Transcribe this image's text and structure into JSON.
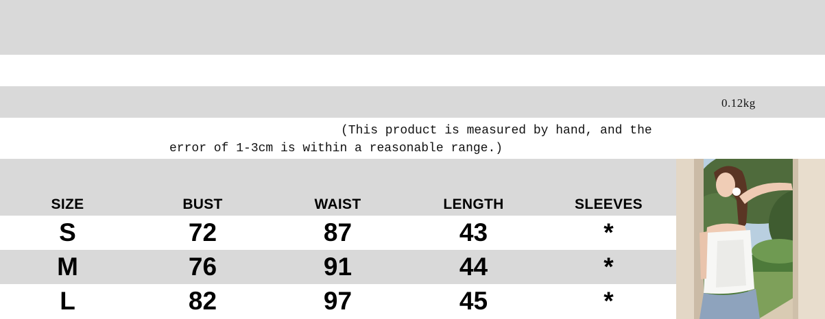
{
  "weight": "0.12kg",
  "note": {
    "line1": "(This product is measured by hand, and the",
    "line2": "error of 1-3cm is within a reasonable range.)"
  },
  "size_chart": {
    "headers": [
      "SIZE",
      "BUST",
      "WAIST",
      "LENGTH",
      "SLEEVES"
    ],
    "rows": [
      [
        "S",
        "72",
        "87",
        "43",
        "*"
      ],
      [
        "M",
        "76",
        "91",
        "44",
        "*"
      ],
      [
        "L",
        "82",
        "97",
        "45",
        "*"
      ]
    ]
  },
  "colors": {
    "band_gray": "#d9d9d9",
    "text": "#000000"
  }
}
